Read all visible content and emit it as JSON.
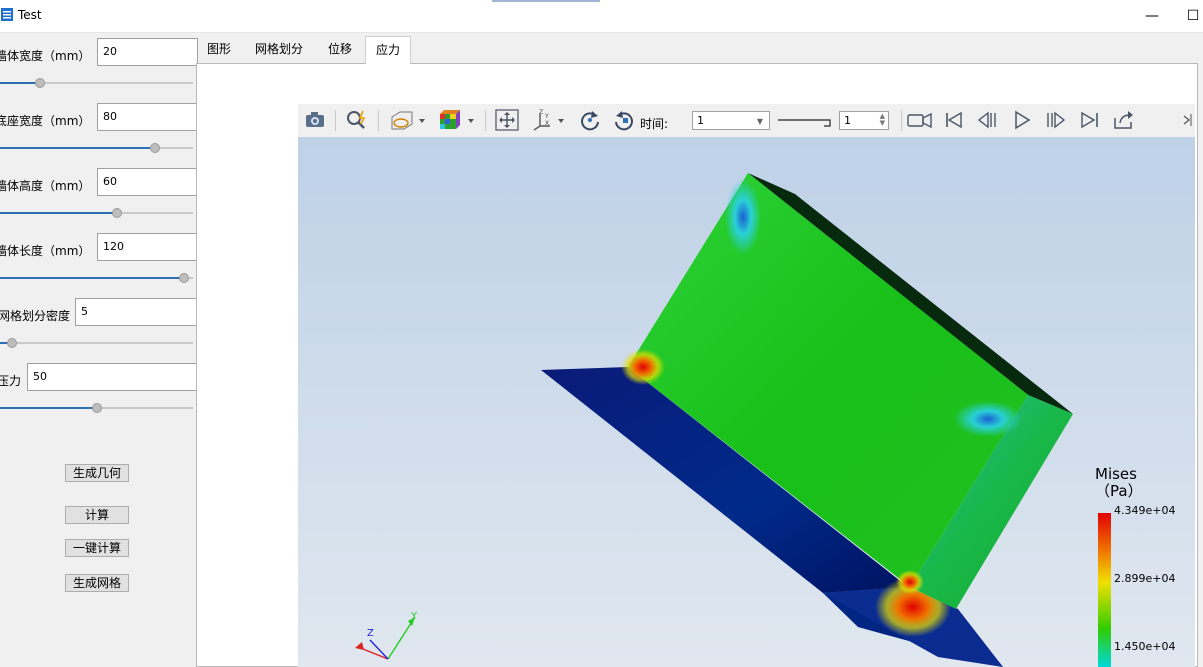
{
  "window": {
    "title": "Test",
    "minimize_glyph": "—",
    "maximize_glyph": "☐"
  },
  "params": [
    {
      "label": "墙体宽度（mm）",
      "value": "20",
      "slider_fraction": 0.19
    },
    {
      "label": "底座宽度（mm）",
      "value": "80",
      "slider_fraction": 0.82
    },
    {
      "label": "墙体高度（mm）",
      "value": "60",
      "slider_fraction": 0.61
    },
    {
      "label": "墙体长度（mm）",
      "value": "120",
      "slider_fraction": 0.98
    },
    {
      "label": "网格划分密度",
      "value": "5",
      "slider_fraction": 0.04
    },
    {
      "label": "压力",
      "value": "50",
      "slider_fraction": 0.5
    }
  ],
  "actions": {
    "generate_geometry": "生成几何",
    "compute": "计算",
    "one_click_compute": "一键计算",
    "generate_mesh": "生成网格"
  },
  "tabs": [
    "图形",
    "网格划分",
    "位移",
    "应力"
  ],
  "active_tab": "应力",
  "toolbar": {
    "time_label": "时间:",
    "time_value": "1",
    "step_value": "1",
    "icons": [
      "camera-icon",
      "zoom-icon",
      "surface-display-icon",
      "color-cube-icon",
      "fit-view-icon",
      "axes-orientation-icon",
      "rotate-cw-icon",
      "rotate-ccw-icon",
      "record-video-icon",
      "first-frame-icon",
      "previous-frame-icon",
      "play-icon",
      "next-frame-icon",
      "last-frame-icon",
      "export-icon"
    ]
  },
  "legend": {
    "title": "Mises\n（Pa）",
    "ticks": [
      "4.349e+04",
      "2.899e+04",
      "1.450e+04"
    ],
    "colors": [
      "#e10000",
      "#f0c000",
      "#33cc00",
      "#00d8d8"
    ]
  },
  "axes": {
    "x": "X",
    "y": "Y",
    "z": "Z"
  },
  "colors": {
    "accent": "#2f6fb6",
    "background_top": "#bed1e7",
    "background_bottom": "#e0e7ef"
  }
}
